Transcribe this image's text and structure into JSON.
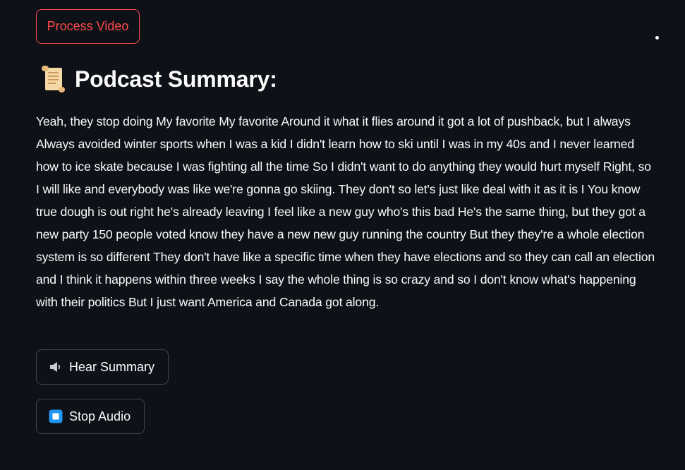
{
  "actions": {
    "process_video_label": "Process Video"
  },
  "summary_section": {
    "title": "Podcast Summary:",
    "title_icon": "scroll-icon",
    "text": "Yeah, they stop doing My favorite My favorite Around it what it flies around it got a lot of pushback, but I always Always avoided winter sports when I was a kid I didn't learn how to ski until I was in my 40s and I never learned how to ice skate because I was fighting all the time So I didn't want to do anything they would hurt myself Right, so I will like and everybody was like we're gonna go skiing. They don't so let's just like deal with it as it is I You know true dough is out right he's already leaving I feel like a new guy who's this bad He's the same thing, but they got a new party 150 people voted know they have a new new guy running the country But they they're a whole election system is so different They don't have like a specific time when they have elections and so they can call an election and I think it happens within three weeks I say the whole thing is so crazy and so I don't know what's happening with their politics But I just want America and Canada got along."
  },
  "audio_controls": {
    "hear_label": "Hear Summary",
    "hear_icon": "speaker-icon",
    "stop_label": "Stop Audio",
    "stop_icon": "stop-icon"
  },
  "colors": {
    "background": "#0e1117",
    "primary_accent": "#ff4b4b",
    "text": "#fafafa",
    "stop_icon_blue": "#2196f3"
  }
}
